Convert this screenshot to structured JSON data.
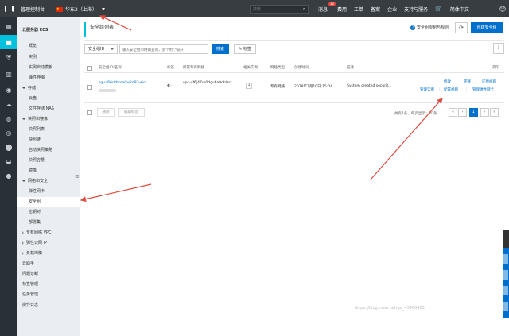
{
  "topbar": {
    "title": "管理控制台",
    "region": "华东2（上海）",
    "search_placeholder": "搜索",
    "nav": [
      {
        "label": "消息",
        "badge": "12"
      },
      {
        "label": "费用"
      },
      {
        "label": "工单"
      },
      {
        "label": "备案"
      },
      {
        "label": "企业"
      },
      {
        "label": "支持与服务"
      },
      {
        "label": "简体中文"
      }
    ]
  },
  "sidebar": {
    "header": "云服务器 ECS",
    "items": [
      {
        "label": "概览"
      },
      {
        "label": "实例"
      },
      {
        "label": "实例启动模板"
      },
      {
        "label": "弹性伸缩"
      },
      {
        "label": "存储",
        "group": true
      },
      {
        "label": "云盘"
      },
      {
        "label": "文件存储 NAS"
      },
      {
        "label": "快照和镜像",
        "group": true
      },
      {
        "label": "快照列表"
      },
      {
        "label": "快照链"
      },
      {
        "label": "自动快照策略"
      },
      {
        "label": "快照容量"
      },
      {
        "label": "镜像"
      },
      {
        "label": "网络和安全",
        "group": true
      },
      {
        "label": "弹性网卡"
      },
      {
        "label": "安全组",
        "selected": true
      },
      {
        "label": "密钥对"
      },
      {
        "label": "部署集"
      },
      {
        "label": "专有网络 VPC",
        "external": true
      },
      {
        "label": "弹性公网 IP",
        "external": true
      },
      {
        "label": "负载均衡",
        "external": true
      },
      {
        "label": "云助手"
      },
      {
        "label": "问题诊断"
      },
      {
        "label": "标签管理"
      },
      {
        "label": "任务管理"
      },
      {
        "label": "操作日志"
      }
    ]
  },
  "main": {
    "title": "安全组列表",
    "help_link": "安全组限制与规则",
    "create_button": "创建安全组",
    "filter": {
      "select_value": "安全组ID",
      "input_placeholder": "输入安全组ID精确查询，多个用\",\"隔开",
      "search_button": "搜索",
      "tag_button": "标签"
    },
    "columns": [
      "安全组ID/名称",
      "标签",
      "所属专有网络",
      "相关实例",
      "网络类型",
      "创建时间",
      "描述",
      "操作"
    ],
    "rows": [
      {
        "id": "sg-uf66r8bzoa0w2q97v6cr",
        "vpc": "vpc-uf6j47ro0dgv6a9ohlzsr",
        "instances": "1",
        "network_type": "专有网络",
        "created": "2018年7月10日 15:04",
        "description": "System created securit...",
        "actions": [
          "修改",
          "克隆",
          "还原规则",
          "管理实例",
          "配置规则",
          "管理弹性网卡"
        ]
      }
    ],
    "footer": {
      "delete_button": "删除",
      "edit_tag_button": "编辑标签",
      "summary": "共有1条，每页显示：20条",
      "pages": [
        "«",
        "‹",
        "1",
        "›",
        "»"
      ]
    }
  },
  "watermark": "https://blog.csdn.net/qq_43460805",
  "colors": {
    "accent": "#0070cc",
    "topbar": "#373d41",
    "arrow": "#e0483b",
    "selected_icon": "#00c1de"
  }
}
